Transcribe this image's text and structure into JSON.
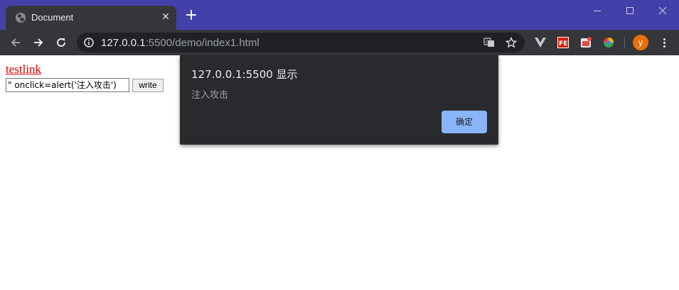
{
  "browser": {
    "tab": {
      "title": "Document"
    },
    "url": {
      "host": "127.0.0.1",
      "rest": ":5500/demo/index1.html"
    },
    "profile": {
      "initial": "y"
    },
    "colors": {
      "frame": "#4340a9",
      "toolbar": "#35363a",
      "omnibox": "#202124",
      "avatar": "#e8710a"
    }
  },
  "page": {
    "link_text": "testlink",
    "input_value": "\" onclick=alert('注入攻击')",
    "button_label": "write",
    "colors": {
      "link": "#e00000"
    }
  },
  "dialog": {
    "title": "127.0.0.1:5500 显示",
    "message": "注入攻击",
    "ok_label": "确定",
    "colors": {
      "background": "#292a2d",
      "button": "#8ab4f8"
    }
  }
}
